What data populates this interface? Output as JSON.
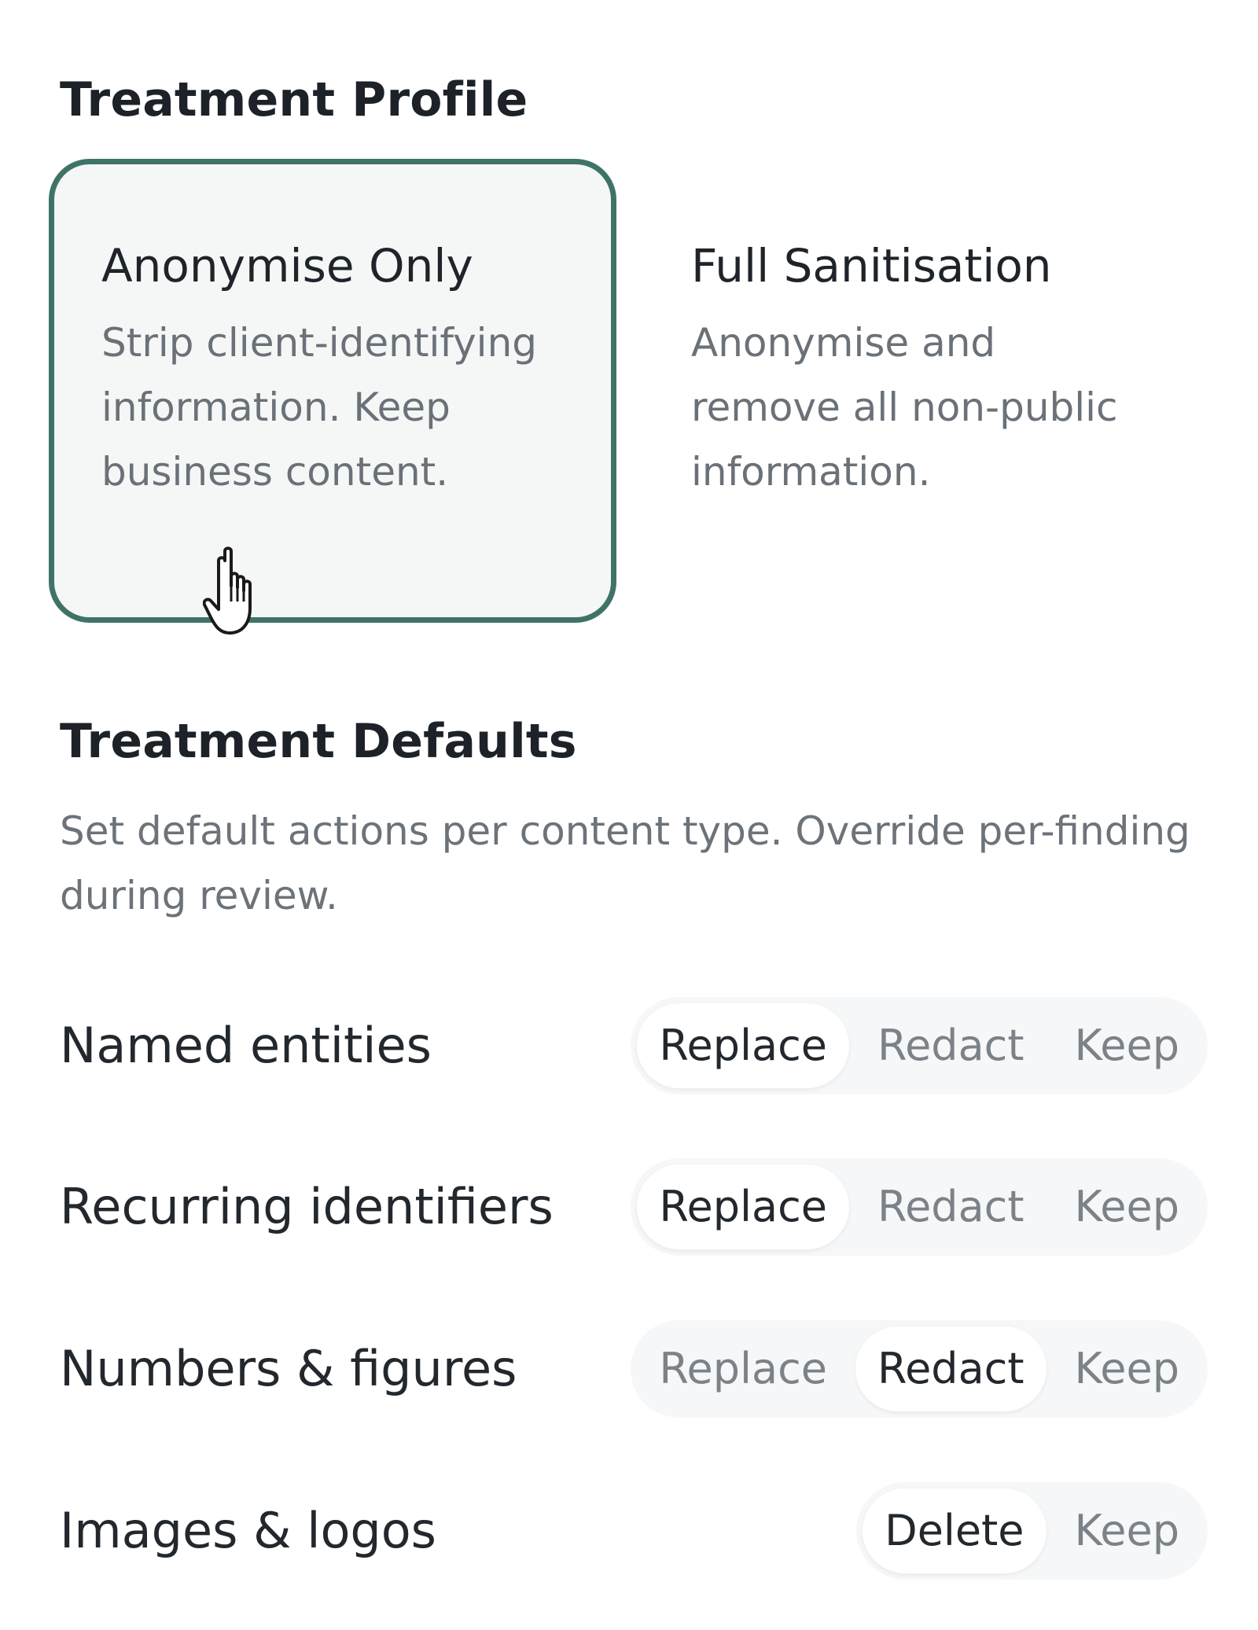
{
  "treatment_profile": {
    "title": "Treatment Profile",
    "options": [
      {
        "title": "Anonymise Only",
        "description": "Strip client-identifying information. Keep business content.",
        "selected": true
      },
      {
        "title": "Full Sanitisation",
        "description": "Anonymise and remove all non-public information.",
        "selected": false
      }
    ]
  },
  "treatment_defaults": {
    "title": "Treatment Defaults",
    "description": "Set default actions per content type. Override per-finding during review.",
    "rows": [
      {
        "label": "Named entities",
        "options": [
          "Replace",
          "Redact",
          "Keep"
        ],
        "selected": "Replace"
      },
      {
        "label": "Recurring identifiers",
        "options": [
          "Replace",
          "Redact",
          "Keep"
        ],
        "selected": "Replace"
      },
      {
        "label": "Numbers & figures",
        "options": [
          "Replace",
          "Redact",
          "Keep"
        ],
        "selected": "Redact"
      },
      {
        "label": "Images & logos",
        "options": [
          "Delete",
          "Keep"
        ],
        "selected": "Delete"
      }
    ]
  },
  "colors": {
    "selected_border": "#3f7368",
    "selected_background": "#f5f7f7",
    "segment_track": "#f6f7f8",
    "segment_active": "#ffffff"
  },
  "icons": {
    "cursor": "hand-pointer-cursor-icon"
  }
}
